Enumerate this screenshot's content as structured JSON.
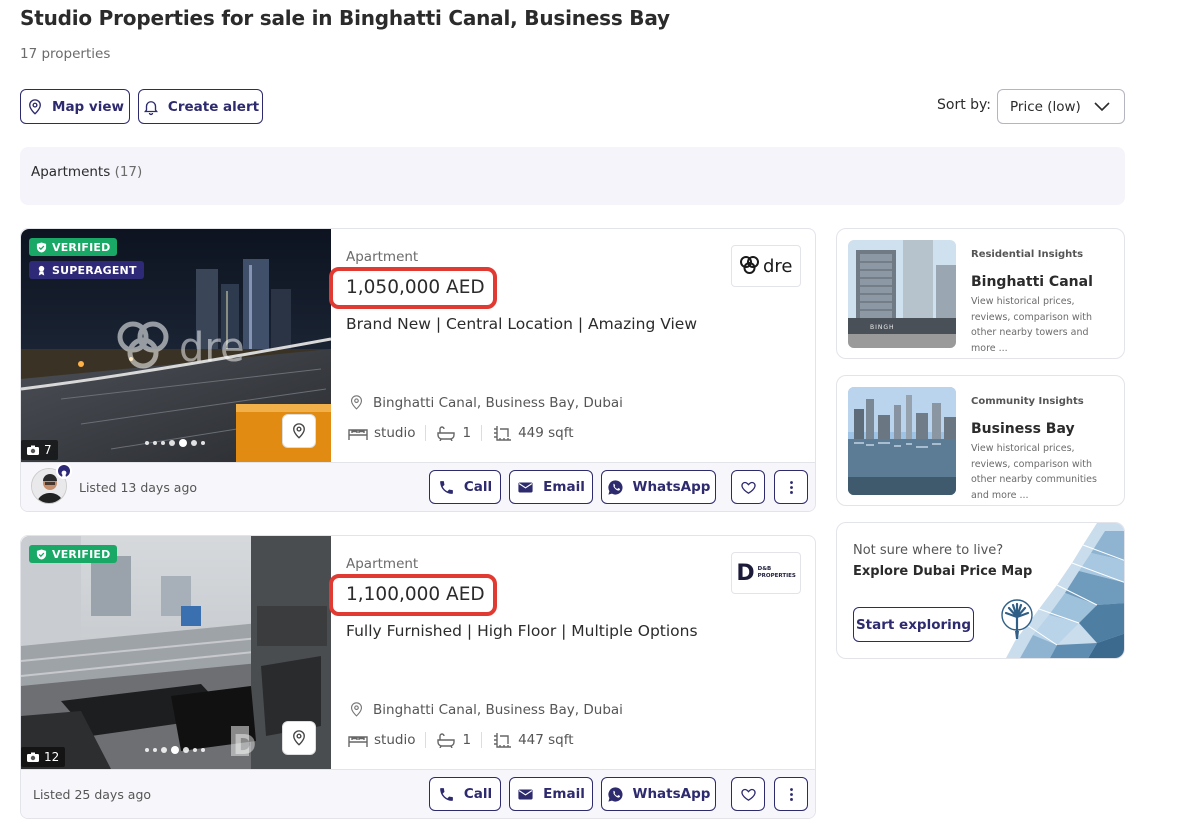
{
  "header": {
    "title": "Studio Properties for sale in Binghatti Canal, Business Bay",
    "count": "17 properties"
  },
  "toolbar": {
    "map_view": "Map view",
    "create_alert": "Create alert",
    "sort_label": "Sort by:",
    "sort_value": "Price (low)"
  },
  "filter": {
    "label": "Apartments",
    "count": "(17)"
  },
  "listings": [
    {
      "badges": [
        "VERIFIED",
        "SUPERAGENT"
      ],
      "photo_count": "7",
      "type": "Apartment",
      "price": "1,050,000 AED",
      "title": "Brand New | Central Location | Amazing View",
      "location": "Binghatti Canal, Business Bay, Dubai",
      "bedrooms": "studio",
      "bathrooms": "1",
      "area": "449 sqft",
      "agency_logo_text": "dre",
      "watermark": "dre",
      "listed": "Listed 13 days ago"
    },
    {
      "badges": [
        "VERIFIED"
      ],
      "photo_count": "12",
      "type": "Apartment",
      "price": "1,100,000 AED",
      "title": "Fully Furnished | High Floor | Multiple Options",
      "location": "Binghatti Canal, Business Bay, Dubai",
      "bedrooms": "studio",
      "bathrooms": "1",
      "area": "447 sqft",
      "agency_logo_text": "D&B PROPERTIES",
      "agency_logo_mark": "D",
      "listed": "Listed 25 days ago"
    }
  ],
  "actions": {
    "call": "Call",
    "email": "Email",
    "whatsapp": "WhatsApp"
  },
  "insights": [
    {
      "kicker": "Residential Insights",
      "name": "Binghatti Canal",
      "desc": "View historical prices, reviews, comparison with other nearby towers and more ..."
    },
    {
      "kicker": "Community Insights",
      "name": "Business Bay",
      "desc": "View historical prices, reviews, comparison with other nearby communities and more ..."
    }
  ],
  "explore": {
    "question": "Not sure where to live?",
    "heading": "Explore Dubai Price Map",
    "button": "Start exploring"
  },
  "colors": {
    "brand": "#2d2a6e",
    "verified": "#1aa867",
    "superagent": "#2e2a78",
    "highlight": "#e03a32"
  }
}
